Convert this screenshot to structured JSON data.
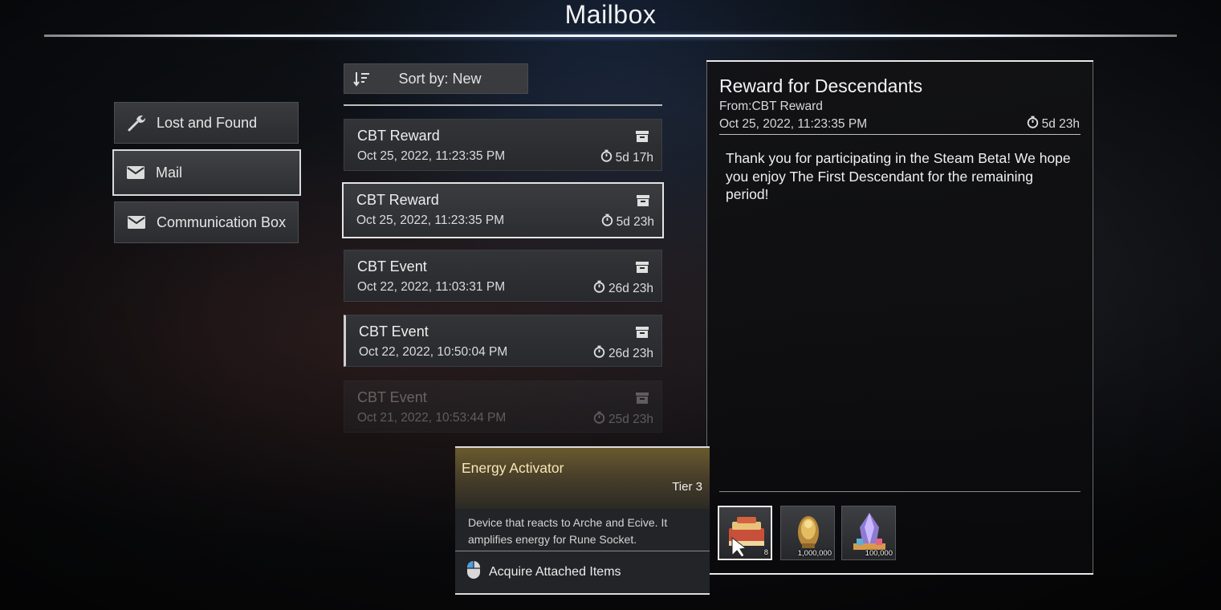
{
  "header": {
    "title": "Mailbox"
  },
  "sidebar": {
    "items": [
      {
        "label": "Lost and Found",
        "icon": "wrench-icon"
      },
      {
        "label": "Mail",
        "icon": "envelope-icon"
      },
      {
        "label": "Communication Box",
        "icon": "envelope-icon"
      }
    ],
    "active_index": 1
  },
  "sort": {
    "label": "Sort by: New",
    "icon": "sort-descending-icon"
  },
  "mails": [
    {
      "sender": "CBT Reward",
      "date": "Oct 25, 2022, 11:23:35 PM",
      "expires": "5d 17h"
    },
    {
      "sender": "CBT Reward",
      "date": "Oct 25, 2022, 11:23:35 PM",
      "expires": "5d 23h"
    },
    {
      "sender": "CBT Event",
      "date": "Oct 22, 2022, 11:03:31 PM",
      "expires": "26d 23h"
    },
    {
      "sender": "CBT Event",
      "date": "Oct 22, 2022, 10:50:04 PM",
      "expires": "26d 23h"
    },
    {
      "sender": "CBT Event",
      "date": "Oct 21, 2022, 10:53:44 PM",
      "expires": "25d 23h"
    }
  ],
  "selected_mail_index": 1,
  "detail": {
    "title": "Reward for Descendants",
    "from": "From:CBT Reward",
    "date": "Oct 25, 2022, 11:23:35 PM",
    "expires": "5d 23h",
    "body": "Thank you for participating in the Steam Beta! We hope you enjoy The First Descendant for the remaining period!",
    "attachments": [
      {
        "name": "Energy Activator",
        "quantity": "8"
      },
      {
        "name": "gold-item",
        "quantity": "1,000,000"
      },
      {
        "name": "crystal-item",
        "quantity": "100,000"
      }
    ]
  },
  "tooltip": {
    "name": "Energy Activator",
    "tier": "Tier 3",
    "description": "Device that reacts to Arche and Ecive. It amplifies energy for Rune Socket.",
    "action": "Acquire Attached Items"
  },
  "colors": {
    "tooltip_header": "#6a5a2e",
    "tooltip_name": "#f6e7b6"
  }
}
